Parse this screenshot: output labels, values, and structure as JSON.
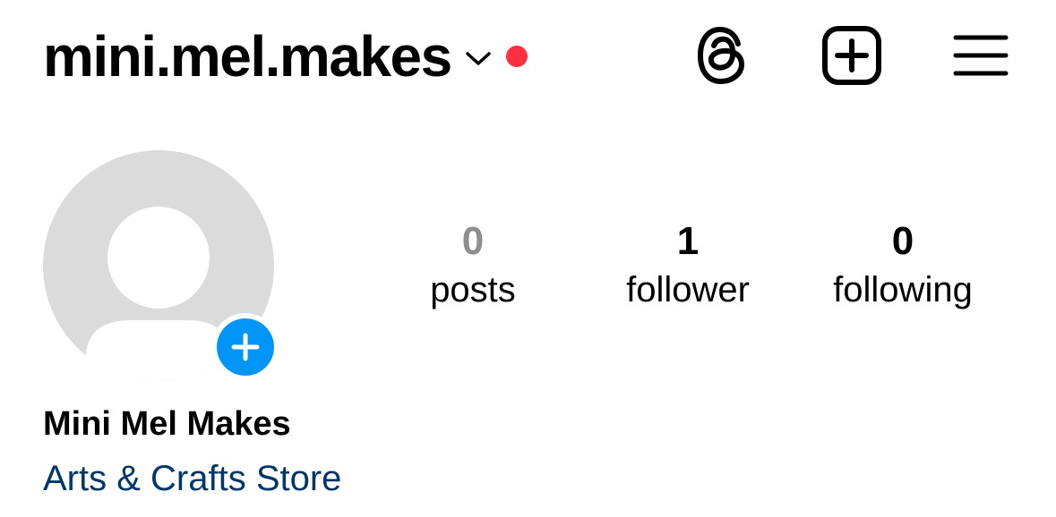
{
  "header": {
    "username": "mini.mel.makes",
    "chevron_icon": "chevron-down-icon",
    "notification_dot_color": "#ff3040",
    "icons": [
      "threads-icon",
      "create-plus-icon",
      "hamburger-menu-icon"
    ]
  },
  "profile": {
    "avatar_icon": "default-avatar-icon",
    "add_story_icon": "plus-icon",
    "add_story_color": "#0095f6",
    "display_name": "Mini Mel Makes",
    "category": "Arts & Crafts Store",
    "category_color": "#00376b"
  },
  "stats": {
    "posts": {
      "count": "0",
      "label": "posts",
      "count_color": "#8e8e8e"
    },
    "followers": {
      "count": "1",
      "label": "follower"
    },
    "following": {
      "count": "0",
      "label": "following"
    }
  }
}
